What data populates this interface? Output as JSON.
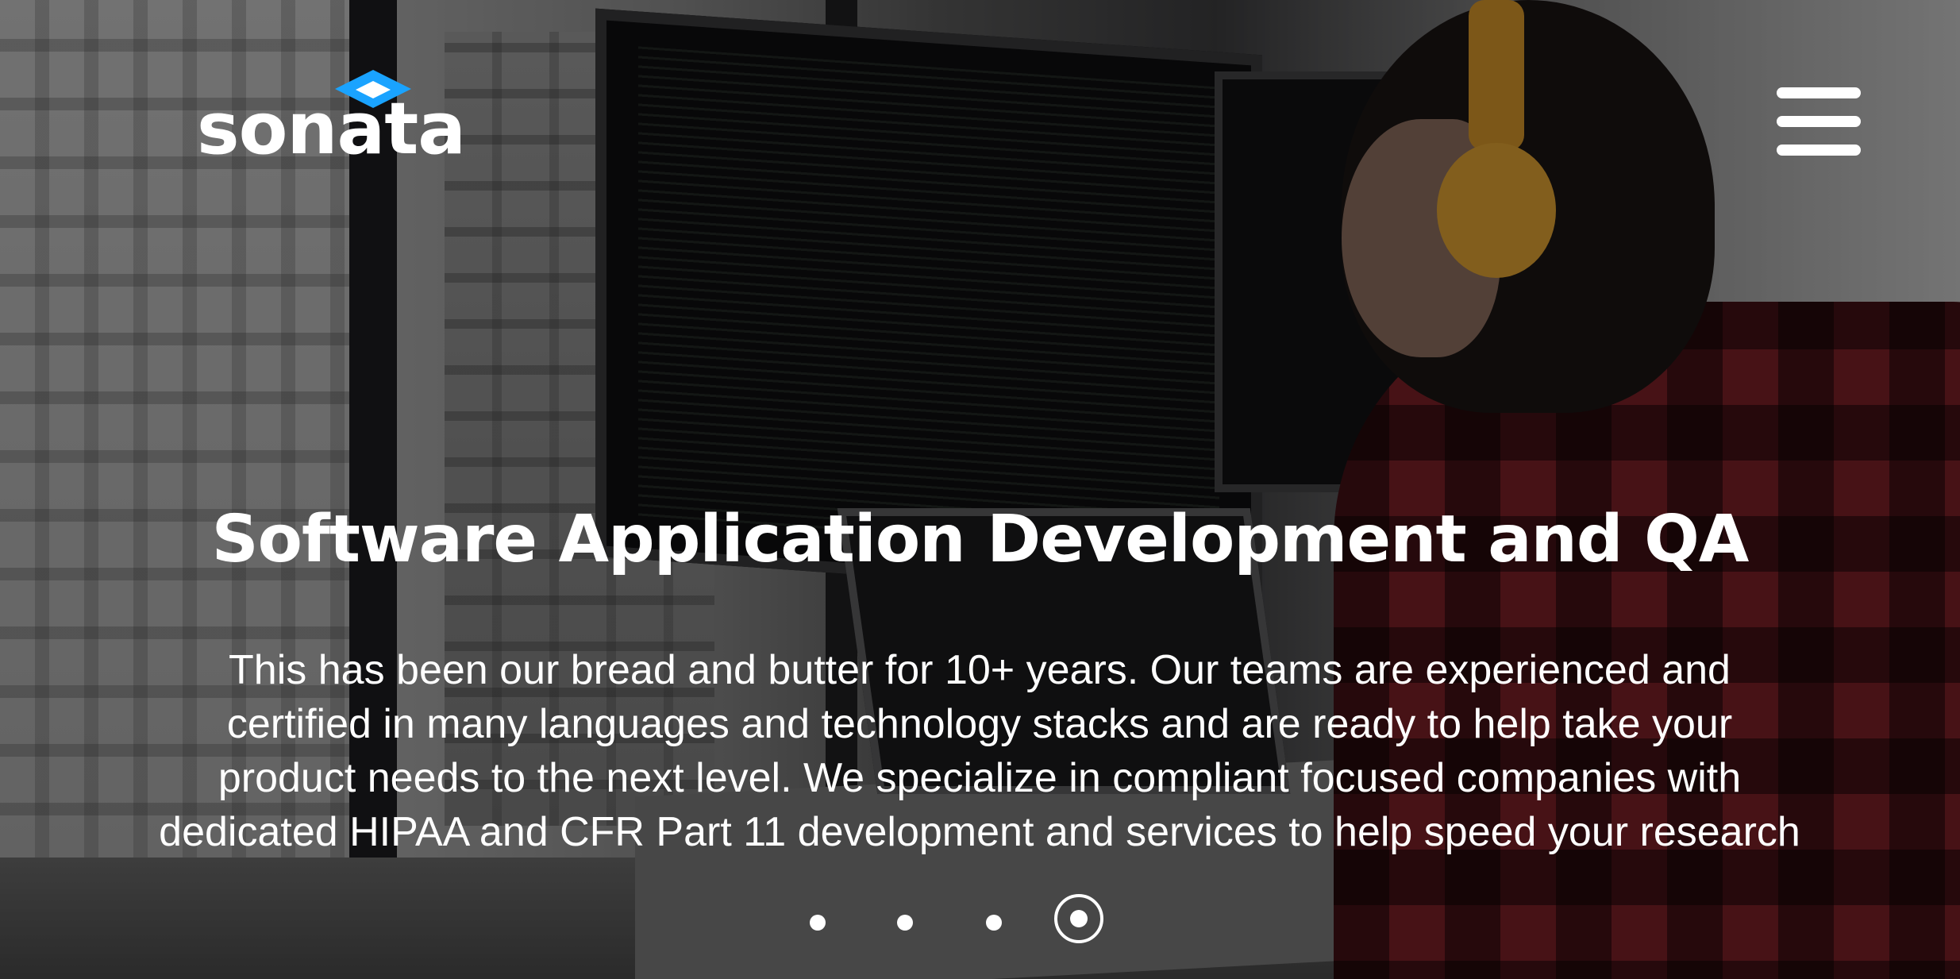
{
  "brand": {
    "name": "sonata",
    "accent_color": "#1aa3ff"
  },
  "nav": {
    "menu_icon": "hamburger-icon"
  },
  "hero": {
    "title": "Software Application Development and QA",
    "description_lines": [
      "This has been our bread and butter for 10+ years. Our teams are experienced and",
      "certified in many languages and technology stacks and are ready to help take your",
      "product needs to the next level. We specialize in compliant focused companies with",
      "dedicated HIPAA and CFR Part 11 development and services to help speed your research"
    ]
  },
  "carousel": {
    "slide_count": 4,
    "active_slide": 4
  }
}
